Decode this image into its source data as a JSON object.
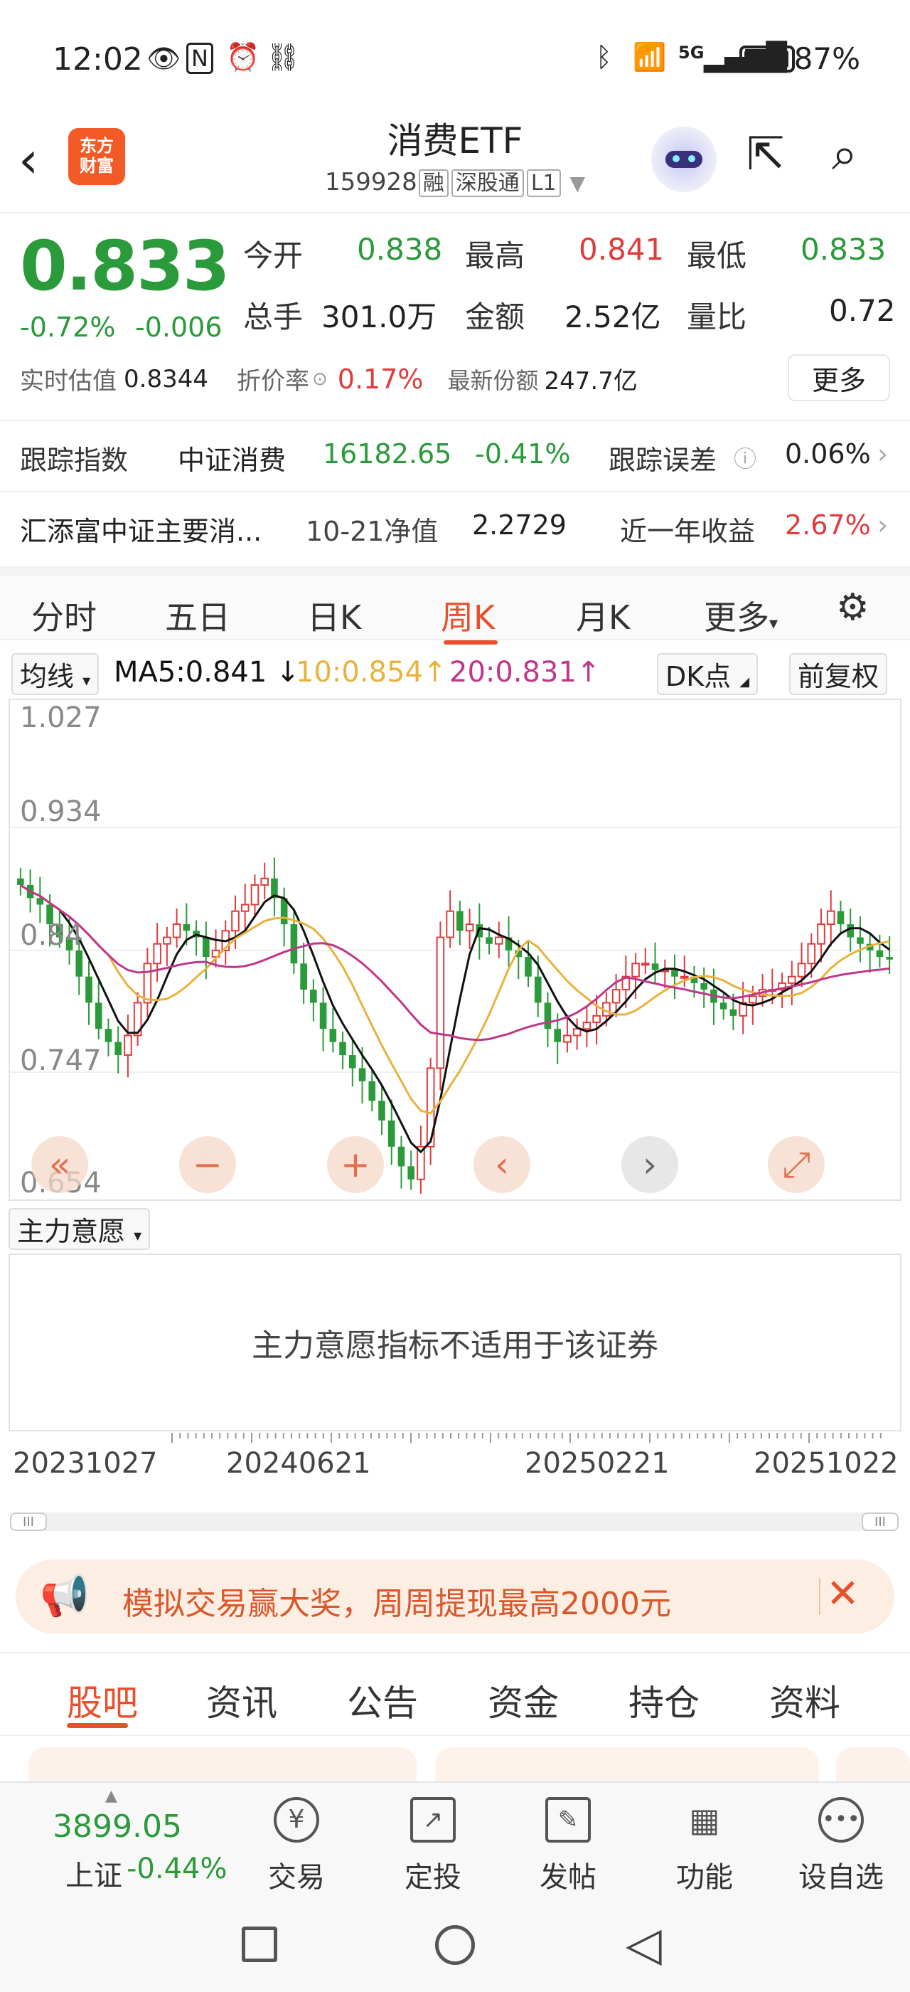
{
  "status_bar": {
    "time": "12:02",
    "battery": "87%",
    "network": "5G"
  },
  "header": {
    "logo_line1": "东方",
    "logo_line2": "财富",
    "title": "消费ETF",
    "code": "159928",
    "badges": [
      "融",
      "深股通",
      "L1"
    ]
  },
  "quote": {
    "price": "0.833",
    "change_pct": "-0.72%",
    "change_val": "-0.006",
    "fields": [
      {
        "label": "今开",
        "value": "0.838",
        "color": "green"
      },
      {
        "label": "最高",
        "value": "0.841",
        "color": "red"
      },
      {
        "label": "最低",
        "value": "0.833",
        "color": "green"
      },
      {
        "label": "总手",
        "value": "301.0万",
        "color": "black"
      },
      {
        "label": "金额",
        "value": "2.52亿",
        "color": "black"
      },
      {
        "label": "量比",
        "value": "0.72",
        "color": "black"
      }
    ],
    "iopv_label": "实时估值",
    "iopv_value": "0.8344",
    "discount_label": "折价率",
    "discount_value": "0.17%",
    "shares_label": "最新份额",
    "shares_value": "247.7亿",
    "more_label": "更多"
  },
  "tracking": {
    "label": "跟踪指数",
    "index_name": "中证消费",
    "index_value": "16182.65",
    "index_change": "-0.41%",
    "error_label": "跟踪误差",
    "error_value": "0.06%"
  },
  "fund": {
    "name": "汇添富中证主要消...",
    "nav_label": "10-21净值",
    "nav_value": "2.2729",
    "return_label": "近一年收益",
    "return_value": "2.67%"
  },
  "period_tabs": [
    "分时",
    "五日",
    "日K",
    "周K",
    "月K",
    "更多"
  ],
  "ma_bar": {
    "select": "均线",
    "ma5": "MA5:0.841",
    "ma10": "10:0.854",
    "ma20": "20:0.831",
    "dk_button": "DK点",
    "adjust_button": "前复权"
  },
  "chart_data": {
    "type": "candlestick",
    "y_labels": [
      "1.027",
      "0.934",
      "0.84",
      "0.747",
      "0.654"
    ],
    "ylim": [
      0.654,
      1.027
    ],
    "x_labels": [
      "20231027",
      "20240621",
      "20250221",
      "20251022"
    ],
    "close_approx": [
      0.89,
      0.88,
      0.875,
      0.86,
      0.85,
      0.84,
      0.82,
      0.8,
      0.78,
      0.77,
      0.76,
      0.775,
      0.8,
      0.83,
      0.845,
      0.85,
      0.86,
      0.855,
      0.85,
      0.835,
      0.84,
      0.855,
      0.87,
      0.875,
      0.89,
      0.895,
      0.88,
      0.86,
      0.83,
      0.81,
      0.8,
      0.78,
      0.77,
      0.76,
      0.75,
      0.74,
      0.725,
      0.71,
      0.69,
      0.675,
      0.665,
      0.69,
      0.75,
      0.85,
      0.87,
      0.855,
      0.86,
      0.85,
      0.845,
      0.85,
      0.84,
      0.835,
      0.82,
      0.8,
      0.78,
      0.77,
      0.775,
      0.78,
      0.785,
      0.79,
      0.8,
      0.81,
      0.82,
      0.83,
      0.83,
      0.825,
      0.825,
      0.82,
      0.82,
      0.815,
      0.81,
      0.8,
      0.795,
      0.79,
      0.8,
      0.805,
      0.81,
      0.81,
      0.815,
      0.82,
      0.83,
      0.845,
      0.86,
      0.87,
      0.86,
      0.85,
      0.845,
      0.84,
      0.835,
      0.833
    ],
    "ma5": "0.841",
    "ma10": "0.854",
    "ma20": "0.831",
    "colors": {
      "up": "#e03b3b",
      "down": "#2a9a3a",
      "ma5": "#111111",
      "ma10": "#e8b23c",
      "ma20": "#c0368a"
    }
  },
  "controls": [
    "«",
    "−",
    "+",
    "‹",
    "›",
    "⤢"
  ],
  "indicator": {
    "select": "主力意愿",
    "message": "主力意愿指标不适用于该证券"
  },
  "promo": {
    "text": "模拟交易赢大奖，周周提现最高2000元"
  },
  "news_tabs": [
    "股吧",
    "资讯",
    "公告",
    "资金",
    "持仓",
    "资料"
  ],
  "bottom": {
    "index_value": "3899.05",
    "index_name": "上证",
    "index_pct": "-0.44%",
    "tools": [
      {
        "label": "交易",
        "icon": "trade-icon"
      },
      {
        "label": "定投",
        "icon": "invest-plan-icon"
      },
      {
        "label": "发帖",
        "icon": "post-icon"
      },
      {
        "label": "功能",
        "icon": "functions-icon"
      },
      {
        "label": "设自选",
        "icon": "add-watchlist-icon"
      }
    ]
  }
}
